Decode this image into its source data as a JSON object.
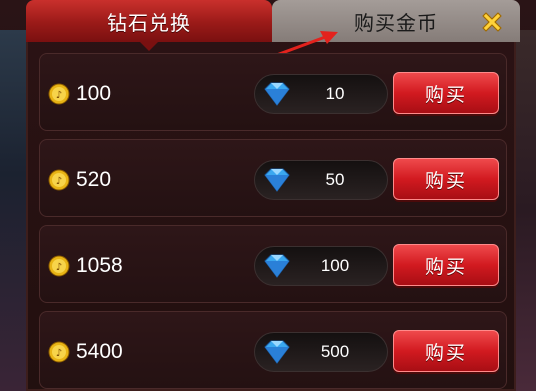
{
  "tabs": {
    "diamond_exchange": "钻石兑换",
    "buy_gold": "购买金币"
  },
  "close_icon": "close-x-icon",
  "colors": {
    "active_tab": "#b2221f",
    "inactive_tab": "#948c88",
    "buy_button": "#d21a20",
    "arrow": "#e3221d"
  },
  "rows": [
    {
      "coins": "100",
      "diamonds": "10",
      "buy_label": "购买"
    },
    {
      "coins": "520",
      "diamonds": "50",
      "buy_label": "购买"
    },
    {
      "coins": "1058",
      "diamonds": "100",
      "buy_label": "购买"
    },
    {
      "coins": "5400",
      "diamonds": "500",
      "buy_label": "购买"
    }
  ]
}
